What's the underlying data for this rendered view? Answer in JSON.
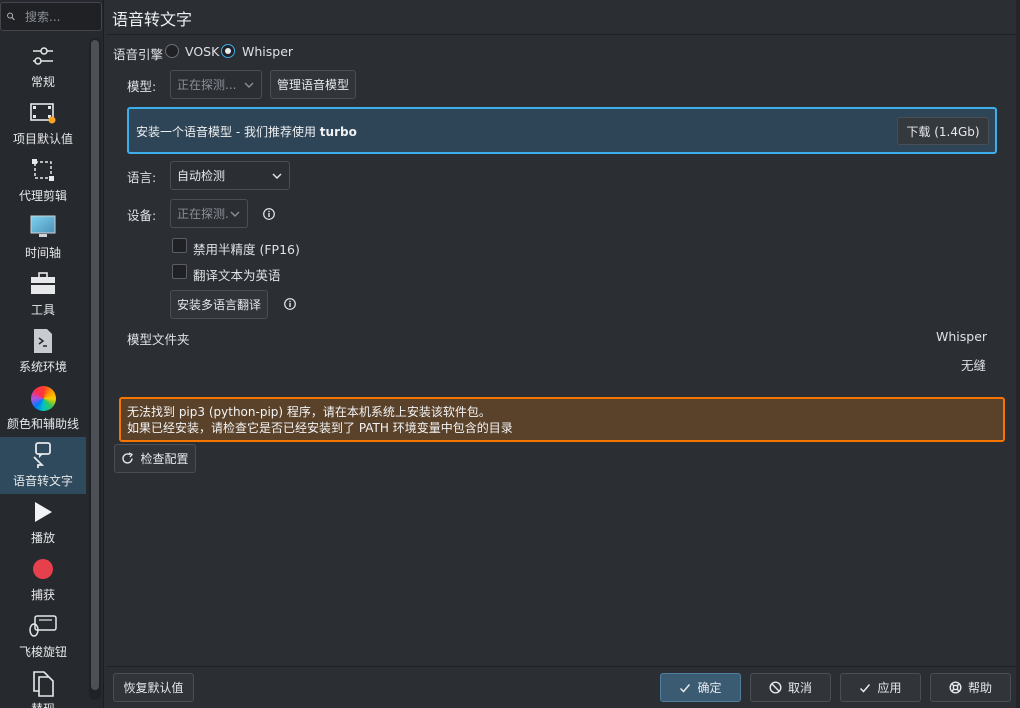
{
  "search": {
    "placeholder": "搜索..."
  },
  "sidebar": {
    "items": [
      {
        "label": "常规",
        "icon": "sliders-icon"
      },
      {
        "label": "项目默认值",
        "icon": "film-icon"
      },
      {
        "label": "代理剪辑",
        "icon": "proxy-icon"
      },
      {
        "label": "时间轴",
        "icon": "monitor-icon"
      },
      {
        "label": "工具",
        "icon": "toolbox-icon"
      },
      {
        "label": "系统环境",
        "icon": "terminal-icon"
      },
      {
        "label": "颜色和辅助线",
        "icon": "color-wheel-icon"
      },
      {
        "label": "语音转文字",
        "icon": "speech-icon"
      },
      {
        "label": "播放",
        "icon": "play-icon"
      },
      {
        "label": "捕获",
        "icon": "record-icon"
      },
      {
        "label": "飞梭旋钮",
        "icon": "jog-shuttle-icon"
      },
      {
        "label": "替现",
        "icon": "copy-icon"
      }
    ],
    "active_index": 7
  },
  "page": {
    "title": "语音转文字"
  },
  "engine": {
    "label": "语音引擎",
    "options": [
      "VOSK",
      "Whisper"
    ],
    "selected": "Whisper"
  },
  "model": {
    "label": "模型:",
    "value": "正在探测...",
    "manage_button": "管理语音模型"
  },
  "install_banner": {
    "message": "安装一个语音模型 - 我们推荐使用",
    "emphasis": "turbo",
    "download_button": "下载 (1.4Gb)"
  },
  "language": {
    "label": "语言:",
    "value": "自动检测"
  },
  "device": {
    "label": "设备:",
    "value": "正在探测."
  },
  "options": {
    "fp16_label": "禁用半精度 (FP16)",
    "translate_label": "翻译文本为英语",
    "install_translation_button": "安装多语言翻译"
  },
  "model_folder": {
    "label": "模型文件夹",
    "engine": "Whisper",
    "value": "无缝"
  },
  "warning": {
    "line1": "无法找到 pip3 (python-pip) 程序，请在本机系统上安装该软件包。",
    "line2": "如果已经安装，请检查它是否已经安装到了 PATH 环境变量中包含的目录"
  },
  "check_config_button": "检查配置",
  "footer": {
    "restore_defaults": "恢复默认值",
    "ok": "确定",
    "cancel": "取消",
    "apply": "应用",
    "help": "帮助"
  },
  "colors": {
    "accent": "#3daee9",
    "warning_border": "#f67400",
    "warning_bg": "#5a4129",
    "info_bg": "#2e4557",
    "active_item": "#2f4a5c"
  }
}
